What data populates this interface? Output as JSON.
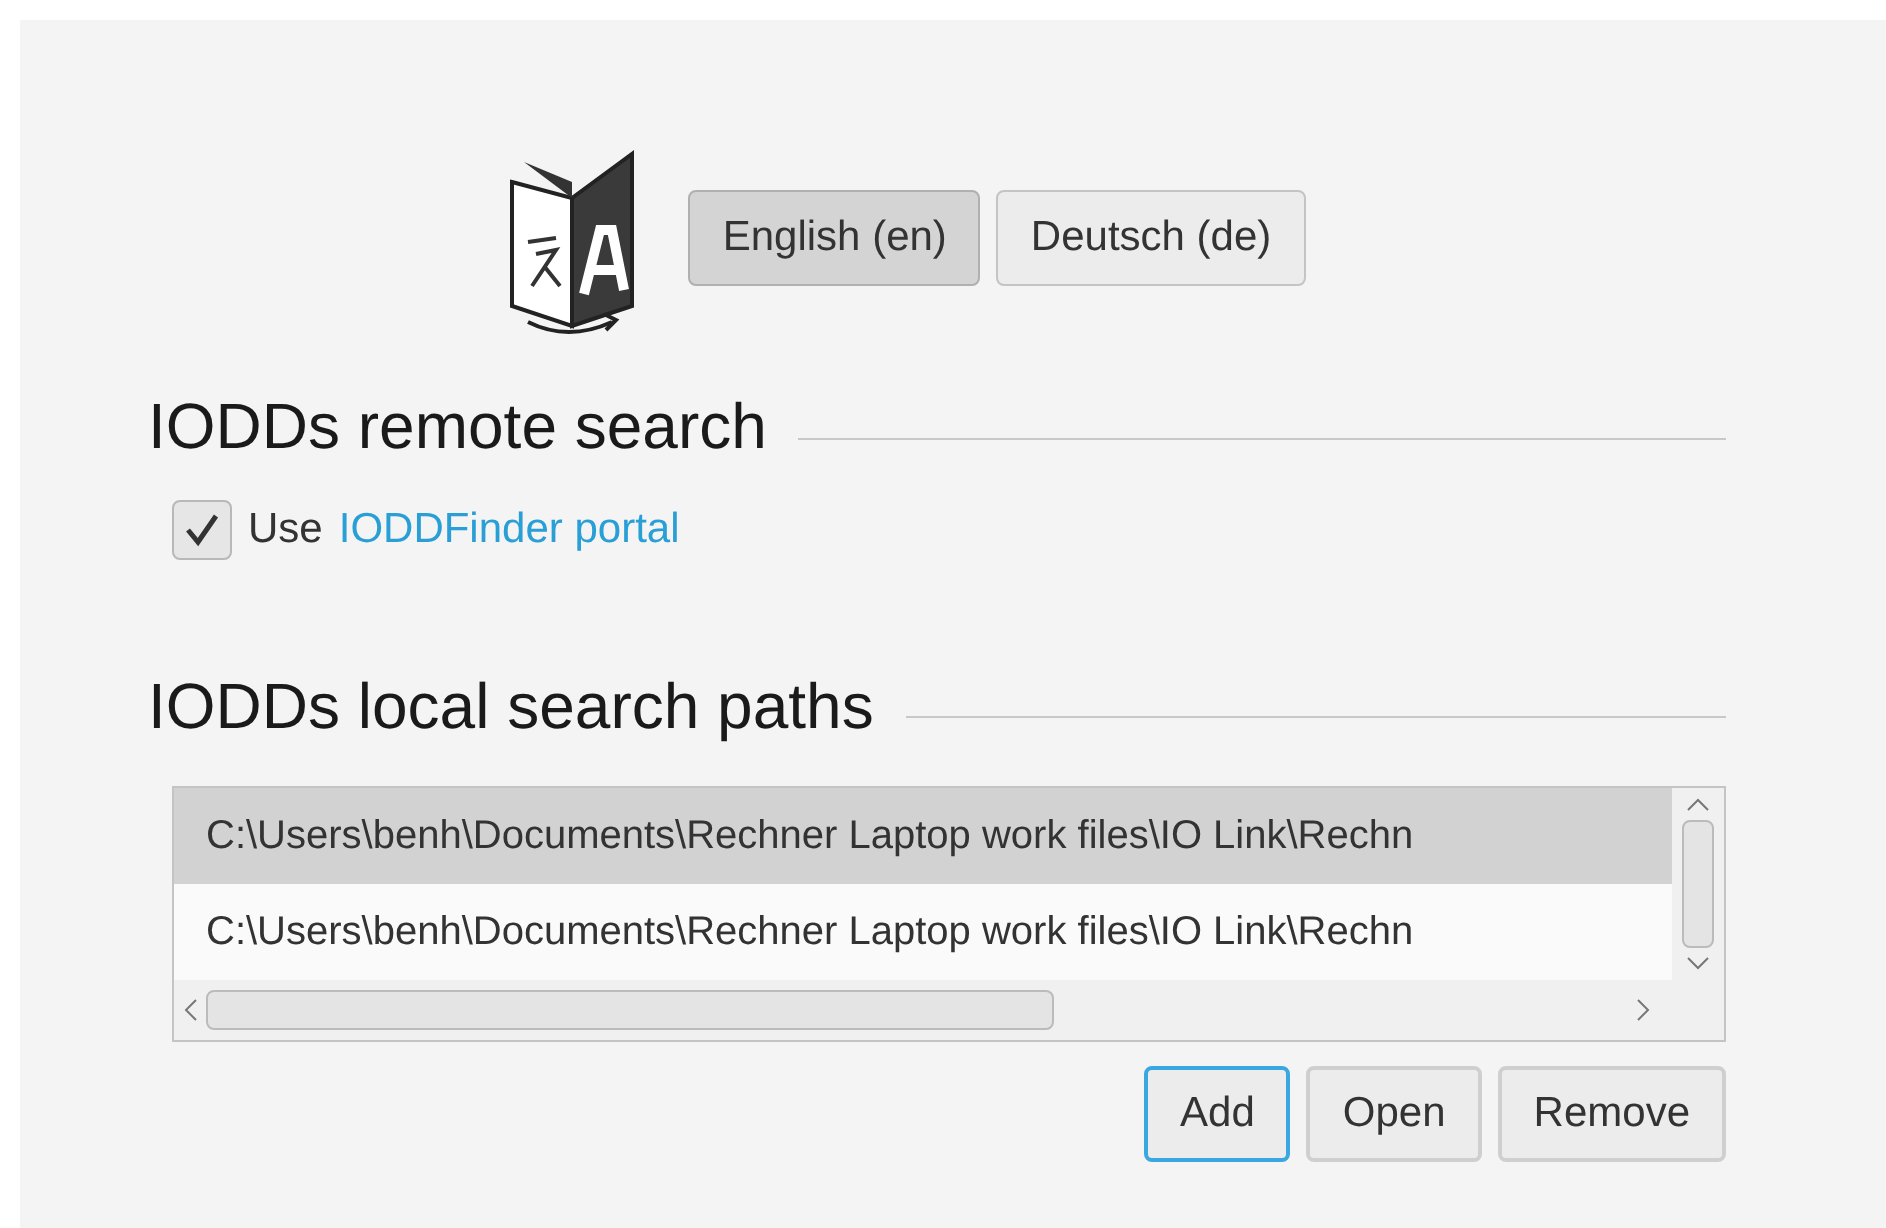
{
  "languages": [
    {
      "label": "English (en)",
      "selected": true
    },
    {
      "label": "Deutsch (de)",
      "selected": false
    }
  ],
  "remote": {
    "heading": "IODDs remote search",
    "checkbox": {
      "label": "Use",
      "link": "IODDFinder portal",
      "checked": true
    }
  },
  "local": {
    "heading": "IODDs local search paths",
    "paths": [
      {
        "text": "C:\\Users\\benh\\Documents\\Rechner Laptop work files\\IO Link\\Rechn",
        "selected": true
      },
      {
        "text": "C:\\Users\\benh\\Documents\\Rechner Laptop work files\\IO Link\\Rechn",
        "selected": false
      }
    ],
    "buttons": [
      {
        "label": "Add",
        "focused": true
      },
      {
        "label": "Open",
        "focused": false
      },
      {
        "label": "Remove",
        "focused": false
      }
    ]
  }
}
